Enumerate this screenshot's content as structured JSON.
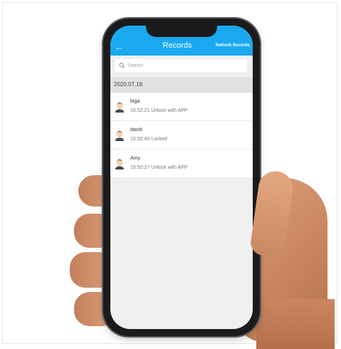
{
  "header": {
    "title": "Records",
    "refresh_label": "Refresh Records",
    "back_icon": "back-arrow-icon",
    "background_color": "#1aa9f0"
  },
  "search": {
    "placeholder": "Search",
    "icon": "search-icon"
  },
  "date_group": "2020.07.18",
  "records": [
    {
      "name": "biga",
      "time_action": "15:52:21 Unlock with APP"
    },
    {
      "name": "david",
      "time_action": "15:50:40 Locked"
    },
    {
      "name": "Amy",
      "time_action": "15:50:27 Unlock with APP"
    }
  ]
}
